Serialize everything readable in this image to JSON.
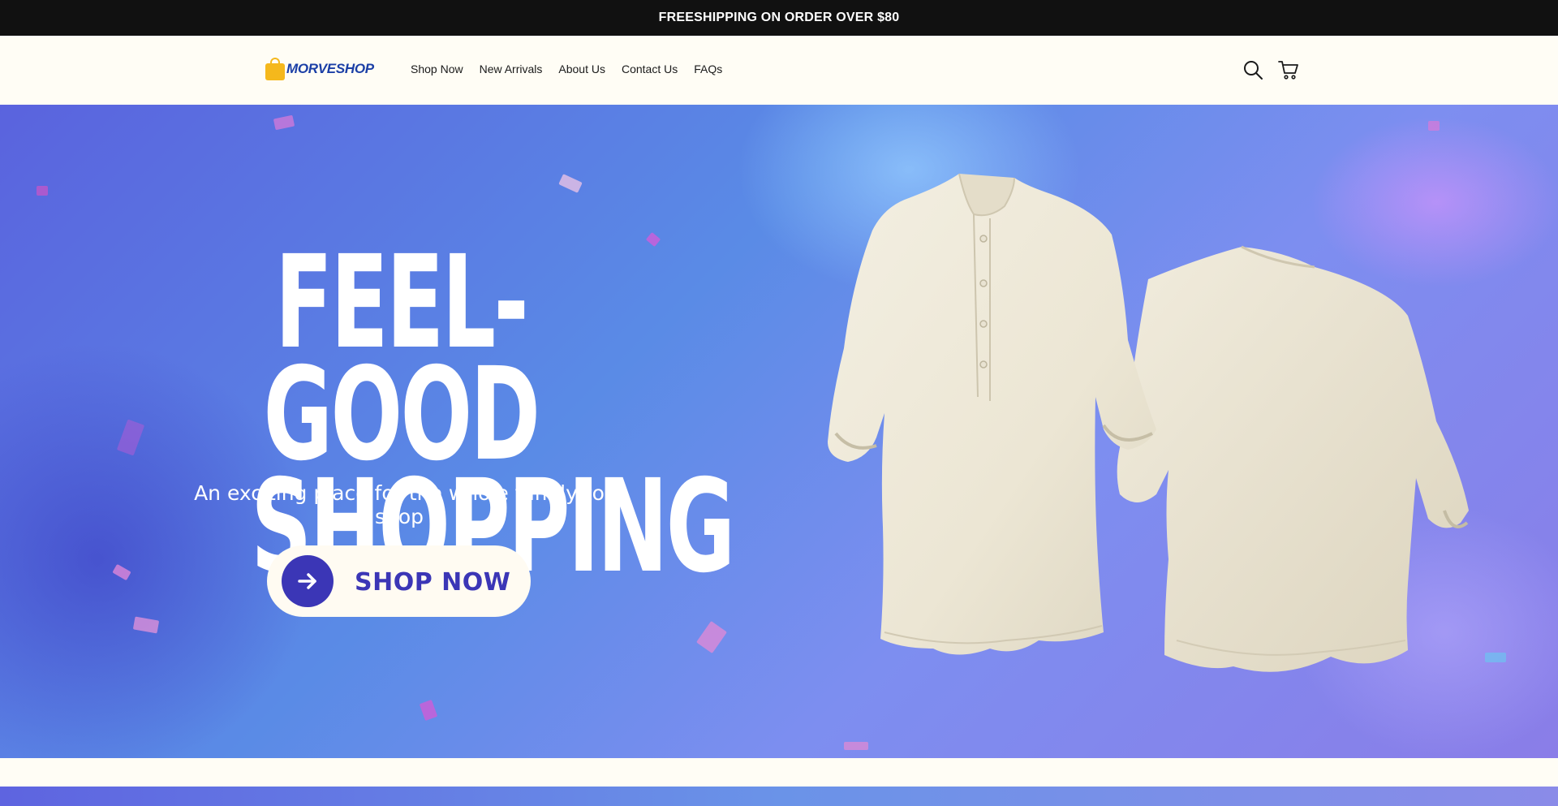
{
  "announcement": {
    "text": "FREESHIPPING ON ORDER OVER $80"
  },
  "header": {
    "logo_text": "MORVESHOP",
    "nav": [
      {
        "label": "Shop Now"
      },
      {
        "label": "New Arrivals"
      },
      {
        "label": "About Us"
      },
      {
        "label": "Contact Us"
      },
      {
        "label": "FAQs"
      }
    ],
    "icons": {
      "search": "search-icon",
      "cart": "cart-icon"
    }
  },
  "hero": {
    "headline_line1": "FEEL-GOOD",
    "headline_line2": "SHOPPING",
    "tagline": "An exciting place for the whole family to shop",
    "cta_label": "SHOP NOW",
    "cta_icon": "arrow-right-icon",
    "image": "linen-shirts-front-back"
  },
  "colors": {
    "announcement_bg": "#111111",
    "header_bg": "#fffdf5",
    "brand_blue": "#1b3fa6",
    "logo_yellow": "#f5b81c",
    "cta_text": "#3b36b6",
    "hero_blue": "#5a63de"
  }
}
